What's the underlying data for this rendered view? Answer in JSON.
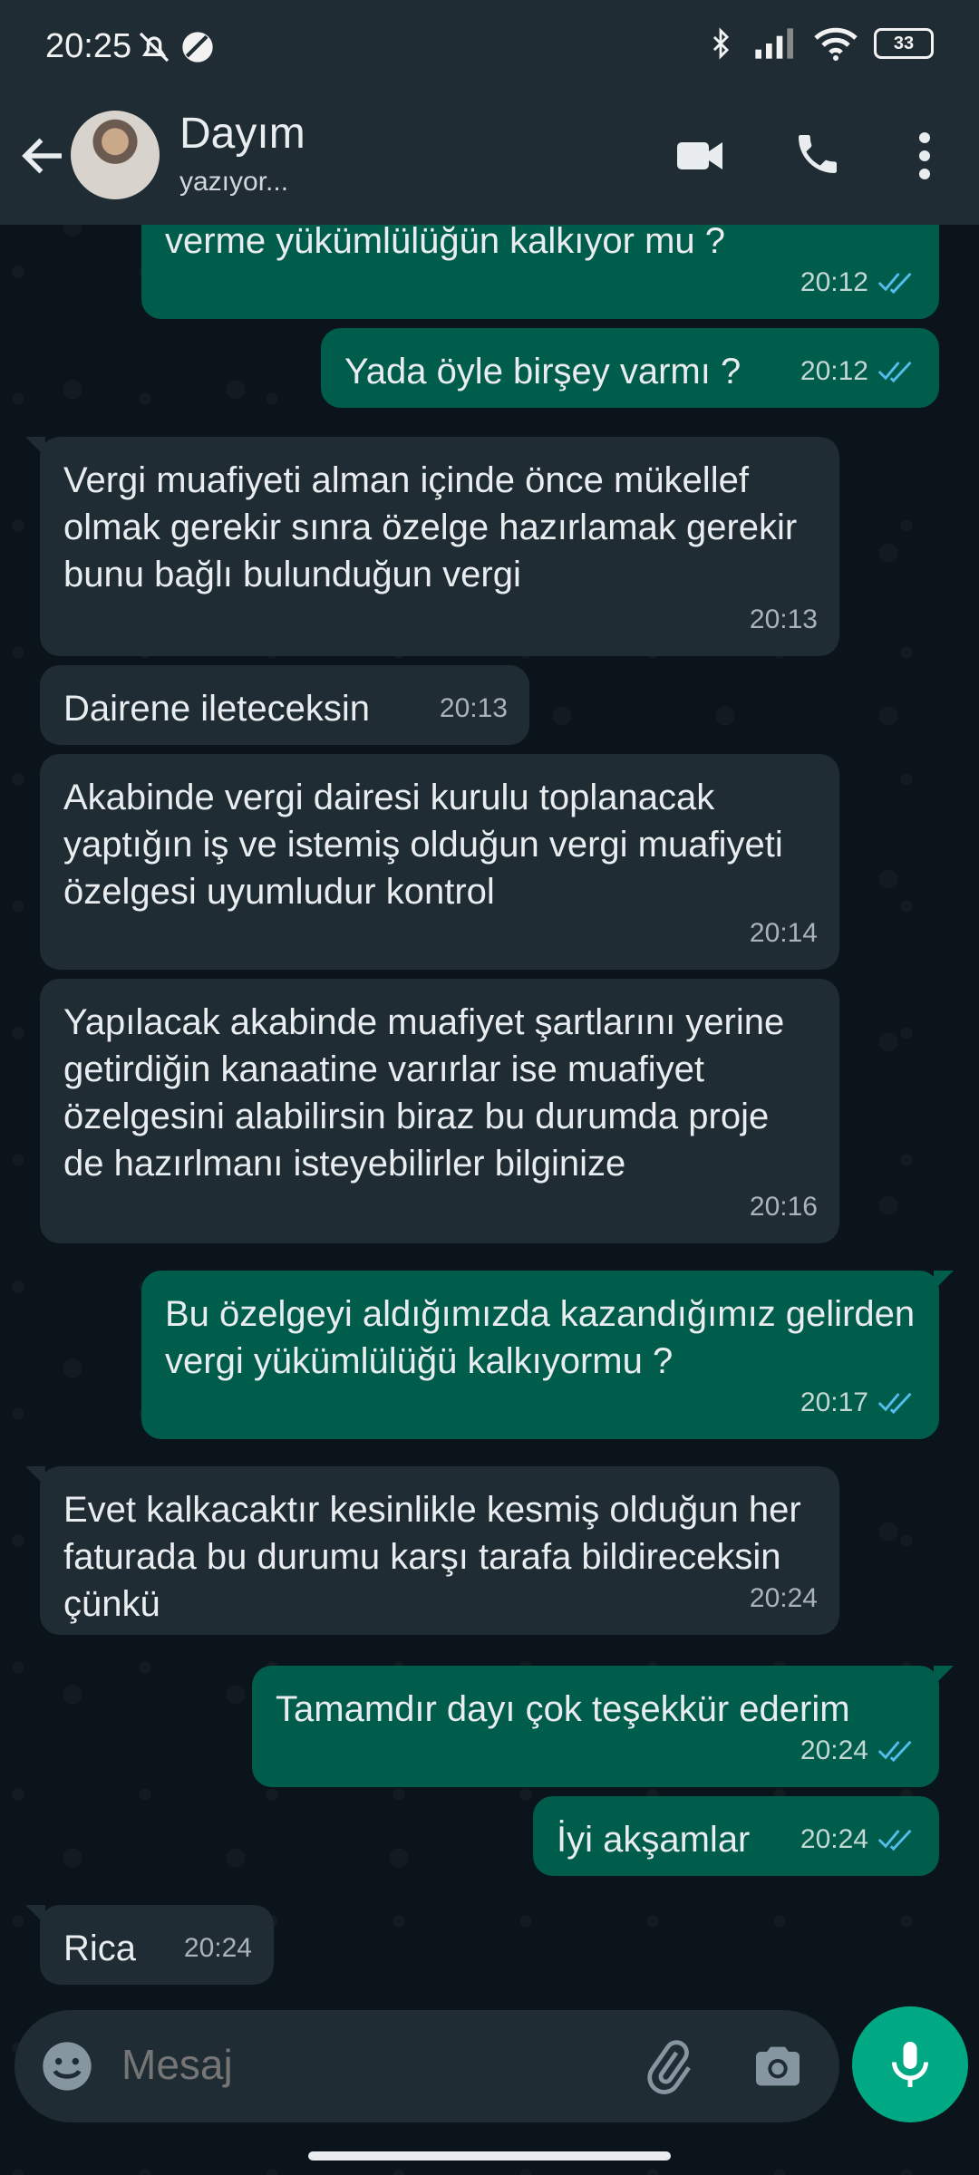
{
  "status_bar": {
    "time": "20:25",
    "battery": "33"
  },
  "header": {
    "contact_name": "Dayım",
    "contact_status": "yazıyor..."
  },
  "messages": [
    {
      "direction": "out",
      "text": "verme yükümlülüğün kalkıyor mu ?",
      "time": "20:12",
      "read": true
    },
    {
      "direction": "out",
      "text": "Yada öyle birşey varmı ?",
      "time": "20:12",
      "read": true
    },
    {
      "direction": "in",
      "text": "Vergi muafiyeti alman içinde önce mükellef olmak gerekir sınra özelge hazırlamak gerekir bunu bağlı bulunduğun vergi",
      "time": "20:13"
    },
    {
      "direction": "in",
      "text": "Dairene ileteceksin",
      "time": "20:13"
    },
    {
      "direction": "in",
      "text": "Akabinde vergi dairesi kurulu toplanacak yaptığın iş ve istemiş olduğun vergi muafiyeti özelgesi uyumludur kontrol",
      "time": "20:14"
    },
    {
      "direction": "in",
      "text": "Yapılacak akabinde muafiyet şartlarını yerine getirdiğin kanaatine varırlar ise muafiyet özelgesini alabilirsin biraz bu durumda proje de hazırlmanı isteyebilirler bilginize",
      "time": "20:16"
    },
    {
      "direction": "out",
      "text": "Bu özelgeyi aldığımızda kazandığımız gelirden vergi yükümlülüğü kalkıyormu ?",
      "time": "20:17",
      "read": true
    },
    {
      "direction": "in",
      "text": "Evet kalkacaktır kesinlikle kesmiş olduğun her faturada bu durumu karşı tarafa bildireceksin çünkü",
      "time": "20:24"
    },
    {
      "direction": "out",
      "text": "Tamamdır dayı çok teşekkür ederim",
      "time": "20:24",
      "read": true
    },
    {
      "direction": "out",
      "text": "İyi akşamlar",
      "time": "20:24",
      "read": true
    },
    {
      "direction": "in",
      "text": "Rica",
      "time": "20:24"
    }
  ],
  "composer": {
    "placeholder": "Mesaj"
  },
  "colors": {
    "background": "#0b141a",
    "bar": "#1f2c34",
    "incoming_bubble": "#1f2c34",
    "outgoing_bubble": "#005c4b",
    "accent": "#00a884",
    "read_ticks": "#53bdeb"
  },
  "icons": [
    "back-arrow-icon",
    "video-call-icon",
    "phone-icon",
    "more-options-icon",
    "emoji-icon",
    "attach-icon",
    "camera-icon",
    "mic-icon",
    "read-ticks-icon",
    "bluetooth-icon",
    "signal-icon",
    "wifi-icon",
    "battery-icon",
    "mute-icon",
    "dnd-icon"
  ]
}
